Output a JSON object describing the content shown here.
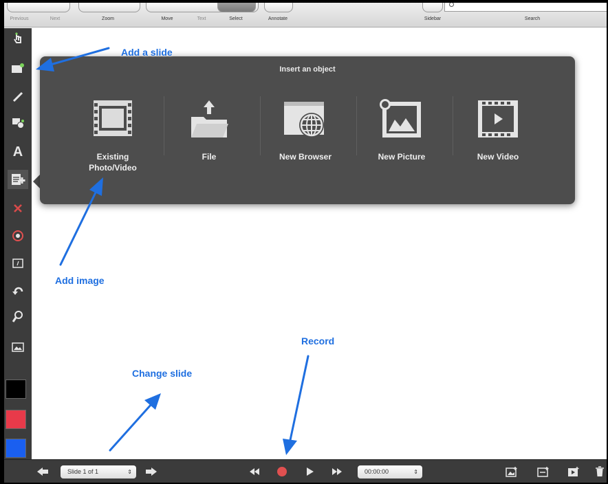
{
  "toolbar": {
    "previous_label": "Previous",
    "next_label": "Next",
    "zoom_label": "Zoom",
    "move_label": "Move",
    "text_label": "Text",
    "select_label": "Select",
    "annotate_label": "Annotate",
    "sidebar_label": "Sidebar",
    "search_label": "Search"
  },
  "popover": {
    "title": "Insert an object",
    "items": [
      {
        "label_line1": "Existing",
        "label_line2": "Photo/Video",
        "icon": "film-strip-icon"
      },
      {
        "label_line1": "File",
        "label_line2": "",
        "icon": "folder-upload-icon"
      },
      {
        "label_line1": "New Browser",
        "label_line2": "",
        "icon": "browser-globe-icon"
      },
      {
        "label_line1": "New Picture",
        "label_line2": "",
        "icon": "picture-icon"
      },
      {
        "label_line1": "New Video",
        "label_line2": "",
        "icon": "video-icon"
      }
    ]
  },
  "callouts": {
    "add_slide": "Add a slide",
    "add_image": "Add image",
    "record": "Record",
    "change_slide": "Change slide"
  },
  "colors": {
    "callout": "#1f6fe0",
    "record": "#e05050",
    "swatch_black": "#000000",
    "swatch_red": "#e83a4a",
    "swatch_blue": "#1a5ff0"
  },
  "bottombar": {
    "slide_indicator": "Slide 1 of 1",
    "time": "00:00:00"
  }
}
